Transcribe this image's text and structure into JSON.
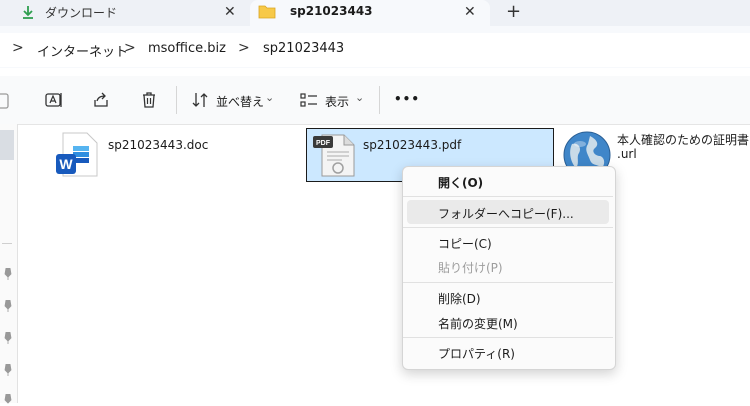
{
  "tabs": [
    {
      "label": "ダウンロード",
      "close": "✕"
    },
    {
      "label": "sp21023443",
      "close": "✕"
    }
  ],
  "new_tab": "+",
  "breadcrumb": [
    "インターネット",
    "msoffice.biz",
    "sp21023443"
  ],
  "breadcrumb_sep": ">",
  "toolbar": {
    "sort_label": "並べ替え",
    "view_label": "表示",
    "more": "•••",
    "chevron": "⌄"
  },
  "files": [
    {
      "name": "sp21023443.doc",
      "icon": "word-doc-icon"
    },
    {
      "name": "sp21023443.pdf",
      "icon": "pdf-file-icon"
    },
    {
      "name_line1": "本人確認のための証明書（",
      "name_line2": ".url",
      "icon": "globe-icon"
    }
  ],
  "context_menu": {
    "open": "開く(O)",
    "copy_to_folder": "フォルダーへコピー(F)...",
    "copy": "コピー(C)",
    "paste": "貼り付け(P)",
    "delete": "削除(D)",
    "rename": "名前の変更(M)",
    "properties": "プロパティ(R)"
  },
  "colors": {
    "selection": "#cce8ff",
    "folder": "#f7c948",
    "download_arrow": "#2e9e4f",
    "word_blue": "#185abd"
  }
}
